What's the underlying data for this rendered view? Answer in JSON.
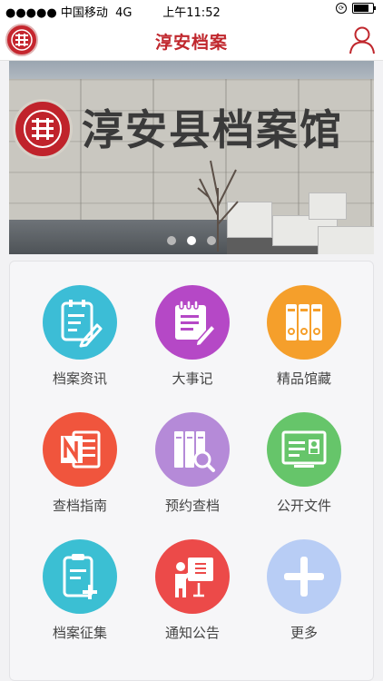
{
  "status_bar": {
    "signal": "●●●●● 中国移动",
    "network": "4G",
    "time": "上午11:52"
  },
  "header": {
    "title": "淳安档案"
  },
  "banner": {
    "sign_text": "淳安县档案馆",
    "active_slide": 2,
    "slide_count": 3
  },
  "menu": [
    {
      "label": "档案资讯",
      "icon": "archive-news-icon",
      "color": "#3cbdd6"
    },
    {
      "label": "大事记",
      "icon": "chronicle-icon",
      "color": "#b548c6"
    },
    {
      "label": "精品馆藏",
      "icon": "collection-binders-icon",
      "color": "#f59f2b"
    },
    {
      "label": "查档指南",
      "icon": "guide-notebook-icon",
      "color": "#f0553d"
    },
    {
      "label": "预约查档",
      "icon": "appointment-search-icon",
      "color": "#b58ad8"
    },
    {
      "label": "公开文件",
      "icon": "public-document-icon",
      "color": "#66c56a"
    },
    {
      "label": "档案征集",
      "icon": "collect-clipboard-icon",
      "color": "#3bbfd3"
    },
    {
      "label": "通知公告",
      "icon": "announcement-icon",
      "color": "#ec4a49"
    },
    {
      "label": "更多",
      "icon": "plus-icon",
      "color": "#b8cdf5"
    }
  ]
}
